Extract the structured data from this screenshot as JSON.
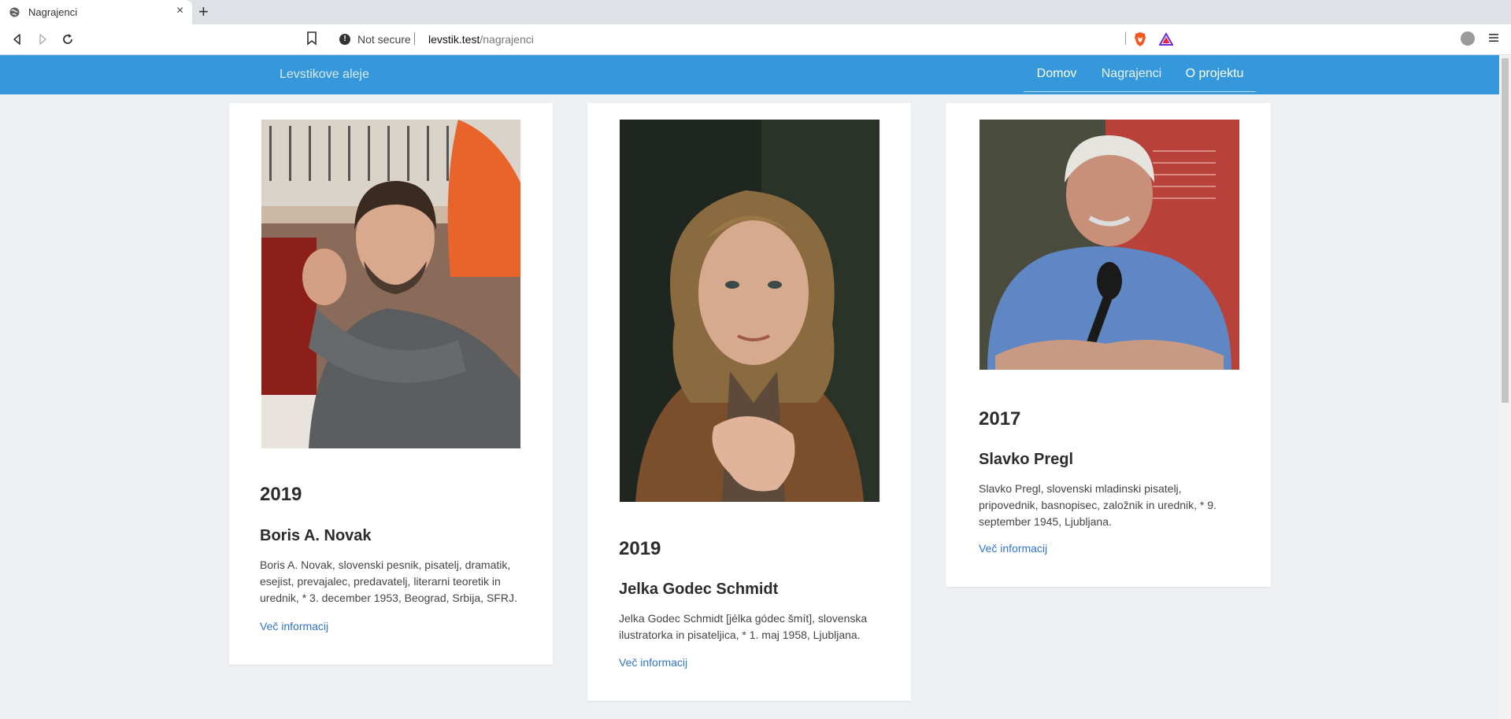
{
  "browser": {
    "tab_title": "Nagrajenci",
    "security_label": "Not secure",
    "url_host": "levstik.test",
    "url_path": "/nagrajenci"
  },
  "site": {
    "brand": "Levstikove aleje",
    "nav": [
      {
        "label": "Domov"
      },
      {
        "label": "Nagrajenci",
        "active": true
      },
      {
        "label": "O projektu"
      }
    ]
  },
  "laureates": [
    {
      "year": "2019",
      "name": "Boris A. Novak",
      "description": "Boris A. Novak, slovenski pesnik, pisatelj, dramatik, esejist, prevajalec, predavatelj, literarni teoretik in urednik, * 3. december 1953, Beograd, Srbija, SFRJ.",
      "link": "Več informacij"
    },
    {
      "year": "2019",
      "name": "Jelka Godec Schmidt",
      "description": "Jelka Godec Schmidt [jélka gódec šmít], slovenska ilustratorka in pisateljica, * 1. maj 1958, Ljubljana.",
      "link": "Več informacij"
    },
    {
      "year": "2017",
      "name": "Slavko Pregl",
      "description": "Slavko Pregl, slovenski mladinski pisatelj, pripovednik, basnopisec, založnik in urednik, * 9. september 1945, Ljubljana.",
      "link": "Več informacij"
    }
  ]
}
